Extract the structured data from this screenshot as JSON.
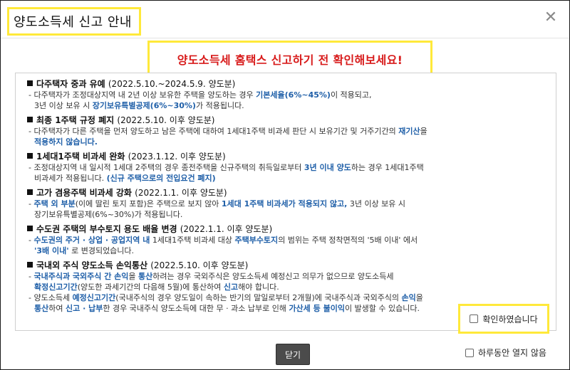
{
  "dialog": {
    "title": "양도소득세 신고 안내",
    "close_symbol": "✕",
    "headline": "양도소득세 홈택스 신고하기 전 확인해보세요!"
  },
  "sections": [
    {
      "title": "다주택자 중과 유예",
      "date": "(2022.5.10.~2024.5.9. 양도분)",
      "lines": [
        {
          "indent": false,
          "parts": [
            {
              "t": "- 다주택자가 조정대상지역 내 2년 이상 보유한 주택을 양도하는 경우 ",
              "h": false
            },
            {
              "t": "기본세율(6%~45%)",
              "h": true
            },
            {
              "t": "이 적용되고,",
              "h": false
            }
          ]
        },
        {
          "indent": true,
          "parts": [
            {
              "t": "3년 이상 보유 시 ",
              "h": false
            },
            {
              "t": "장기보유특별공제(6%~30%)",
              "h": true
            },
            {
              "t": "가 적용됩니다.",
              "h": false
            }
          ]
        }
      ]
    },
    {
      "title": "최종 1주택 규정 폐지",
      "date": "(2022.5.10. 이후 양도분)",
      "lines": [
        {
          "indent": false,
          "parts": [
            {
              "t": "- 다주택자가 다른 주택을 먼저 양도하고 남은 주택에 대하여 1세대1주택 비과세 판단 시 보유기간 및 거주기간의 ",
              "h": false
            },
            {
              "t": "재기산",
              "h": true
            },
            {
              "t": "을",
              "h": false
            }
          ]
        },
        {
          "indent": true,
          "parts": [
            {
              "t": "적용하지 않습니다.",
              "h": true
            }
          ]
        }
      ]
    },
    {
      "title": "1세대1주택 비과세 완화",
      "date": "(2023.1.12. 이후 양도분)",
      "lines": [
        {
          "indent": false,
          "parts": [
            {
              "t": "- 조정대상지역 내 일시적 1세대 2주택의 경우 종전주택을 신규주택의 취득일로부터 ",
              "h": false
            },
            {
              "t": "3년 이내 양도",
              "h": true
            },
            {
              "t": "하는 경우 1세대1주택",
              "h": false
            }
          ]
        },
        {
          "indent": true,
          "parts": [
            {
              "t": "비과세가 적용됩니다. ",
              "h": false
            },
            {
              "t": "(신규 주택으로의 전입요건 폐지)",
              "h": true
            }
          ]
        }
      ]
    },
    {
      "title": "고가 겸용주택 비과세 강화",
      "date": "(2022.1.1. 이후 양도분)",
      "lines": [
        {
          "indent": false,
          "parts": [
            {
              "t": "- ",
              "h": false
            },
            {
              "t": "주택 외 부분",
              "h": true
            },
            {
              "t": "(이에 딸린 토지 포함)은 주택으로 보지 않아 ",
              "h": false
            },
            {
              "t": "1세대 1주택 비과세가 적용되지 않고,",
              "h": true
            },
            {
              "t": " 3년 이상 보유 시",
              "h": false
            }
          ]
        },
        {
          "indent": true,
          "parts": [
            {
              "t": "장기보유특별공제(6%~30%)가 적용됩니다.",
              "h": false
            }
          ]
        }
      ]
    },
    {
      "title": "수도권 주택의 부수토지 용도 배율 변경",
      "date": "(2022.1.1. 이후 양도분)",
      "lines": [
        {
          "indent": false,
          "parts": [
            {
              "t": "- ",
              "h": false
            },
            {
              "t": "수도권의 주거 · 상업 · 공업지역 내",
              "h": true
            },
            {
              "t": " 1세대1주택 비과세 대상 ",
              "h": false
            },
            {
              "t": "주택부수토지",
              "h": true
            },
            {
              "t": "의 범위는 주택 정착면적의 '5배 이내' 에서",
              "h": false
            }
          ]
        },
        {
          "indent": true,
          "parts": [
            {
              "t": "'3배 이내'",
              "h": true
            },
            {
              "t": " 로 변경되었습니다.",
              "h": false
            }
          ]
        }
      ]
    },
    {
      "title": "국내외 주식 양도소득 손익통산",
      "date": "(2022.5.10. 이후 양도분)",
      "lines": [
        {
          "indent": false,
          "parts": [
            {
              "t": "- ",
              "h": false
            },
            {
              "t": "국내주식과 국외주식 간 손익",
              "h": true
            },
            {
              "t": "을 ",
              "h": false
            },
            {
              "t": "통산",
              "h": true
            },
            {
              "t": "하려는 경우 국외주식은 양도소득세 예정신고 의무가 없으므로 양도소득세",
              "h": false
            }
          ]
        },
        {
          "indent": true,
          "parts": [
            {
              "t": "확정신고기간",
              "h": true
            },
            {
              "t": "(양도한 과세기간의 다음해 5월)에 통산하여 ",
              "h": false
            },
            {
              "t": "신고",
              "h": true
            },
            {
              "t": "해야 합니다.",
              "h": false
            }
          ]
        },
        {
          "indent": false,
          "parts": [
            {
              "t": "- 양도소득세 ",
              "h": false
            },
            {
              "t": "예정신고기간",
              "h": true
            },
            {
              "t": "(국내주식의 경우 양도일이 속하는 반기의 말일로부터 2개월)에 국내주식과 국외주식의 ",
              "h": false
            },
            {
              "t": "손익",
              "h": true
            },
            {
              "t": "을",
              "h": false
            }
          ]
        },
        {
          "indent": true,
          "parts": [
            {
              "t": "통산",
              "h": true
            },
            {
              "t": "하여 ",
              "h": false
            },
            {
              "t": "신고 · 납부",
              "h": true
            },
            {
              "t": "한 경우 국내주식 양도소득에 대한 무 · 과소 납부로 인해 ",
              "h": false
            },
            {
              "t": "가산세 등 불이익",
              "h": true
            },
            {
              "t": "이 발생할 수 있습니다.",
              "h": false
            }
          ]
        }
      ]
    }
  ],
  "confirm_label": "확인하였습니다",
  "close_button_label": "닫기",
  "no_show_label": "하루동안 열지 않음",
  "colors": {
    "highlight_border": "#ffe93a",
    "headline": "#d81b1b",
    "emphasis": "#1f5fa8"
  }
}
